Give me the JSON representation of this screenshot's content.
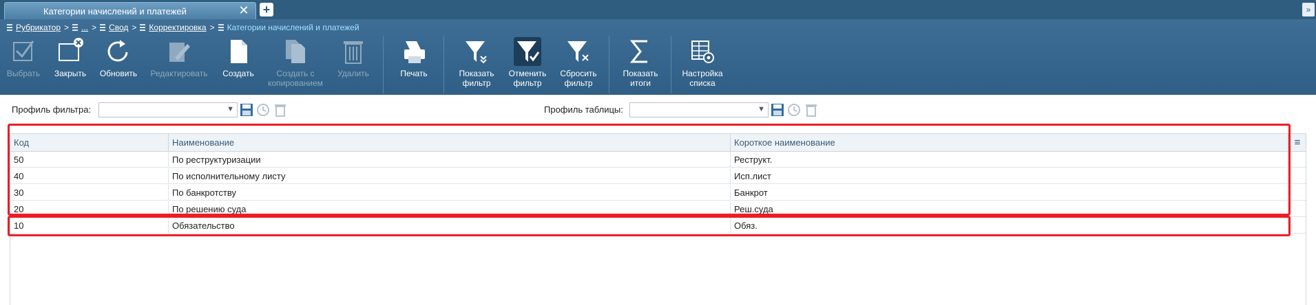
{
  "tabs": [
    {
      "label": "Категории начислений и платежей",
      "active": true
    }
  ],
  "tab_close_glyph": "✕",
  "tab_add_glyph": "+",
  "tab_menu_glyph": "»",
  "breadcrumb": [
    {
      "label": "Рубрикатор",
      "link": true
    },
    {
      "label": "...",
      "link": true
    },
    {
      "label": "Свод",
      "link": true
    },
    {
      "label": "Корректировка",
      "link": true
    },
    {
      "label": "Категории начислений и платежей",
      "link": false
    }
  ],
  "breadcrumb_sep": ">",
  "toolbar": {
    "select": {
      "label": "Выбрать",
      "enabled": false,
      "icon": "checkmark-icon"
    },
    "close": {
      "label": "Закрыть",
      "enabled": true,
      "icon": "window-close-icon"
    },
    "refresh": {
      "label": "Обновить",
      "enabled": true,
      "icon": "refresh-icon"
    },
    "edit": {
      "label": "Редактировать",
      "enabled": false,
      "icon": "edit-icon"
    },
    "create": {
      "label": "Создать",
      "enabled": true,
      "icon": "new-document-icon"
    },
    "create_copy": {
      "label1": "Создать с",
      "label2": "копированием",
      "enabled": false,
      "icon": "copy-document-icon"
    },
    "delete": {
      "label": "Удалить",
      "enabled": false,
      "icon": "trash-icon"
    },
    "print": {
      "label": "Печать",
      "enabled": true,
      "icon": "printer-icon"
    },
    "show_filter": {
      "label1": "Показать",
      "label2": "фильтр",
      "enabled": true,
      "icon": "filter-show-icon"
    },
    "cancel_filter": {
      "label1": "Отменить",
      "label2": "фильтр",
      "enabled": true,
      "active": true,
      "icon": "filter-check-icon"
    },
    "reset_filter": {
      "label1": "Сбросить",
      "label2": "фильтр",
      "enabled": true,
      "icon": "filter-reset-icon"
    },
    "show_totals": {
      "label1": "Показать",
      "label2": "итоги",
      "enabled": true,
      "icon": "sigma-icon"
    },
    "list_settings": {
      "label1": "Настройка",
      "label2": "списка",
      "enabled": true,
      "icon": "table-settings-icon"
    }
  },
  "filter_profile": {
    "label": "Профиль фильтра:",
    "value": ""
  },
  "table_profile": {
    "label": "Профиль таблицы:",
    "value": ""
  },
  "grid": {
    "columns": [
      "Код",
      "Наименование",
      "Короткое наименование"
    ],
    "rows": [
      [
        "50",
        "По реструктуризации",
        "Реструкт."
      ],
      [
        "40",
        "По исполнительному листу",
        "Исп.лист"
      ],
      [
        "30",
        "По банкротству",
        "Банкрот"
      ],
      [
        "20",
        "По решению суда",
        "Реш.суда"
      ],
      [
        "10",
        "Обязательство",
        "Обяз."
      ]
    ],
    "column_menu_glyph": "≡"
  },
  "colors": {
    "header_bg": "#2f5f86",
    "tab_bg": "#5b8db3",
    "highlight": "#ee1c25",
    "breadcrumb_current": "#9fe3ff"
  }
}
